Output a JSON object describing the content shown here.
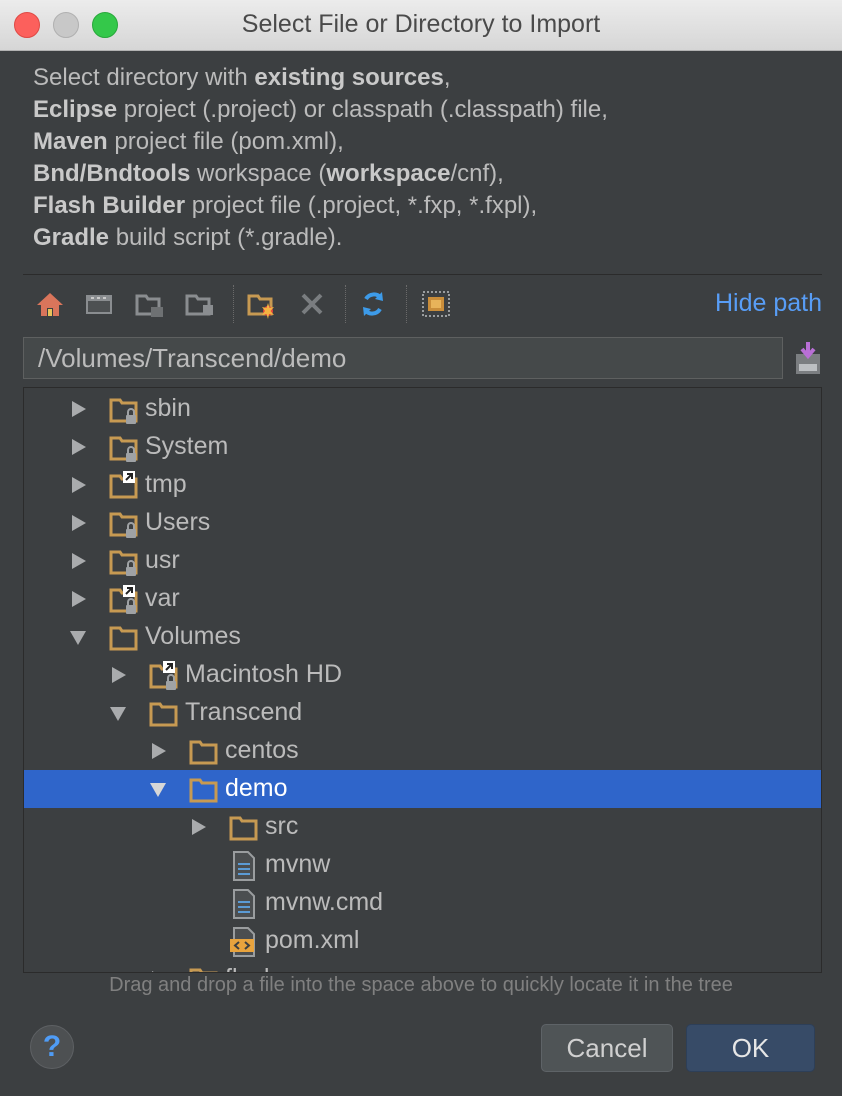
{
  "window": {
    "title": "Select File or Directory to Import"
  },
  "description": [
    [
      {
        "t": "Select directory with ",
        "b": false
      },
      {
        "t": "existing sources",
        "b": true
      },
      {
        "t": ",",
        "b": false
      }
    ],
    [
      {
        "t": "Eclipse",
        "b": true
      },
      {
        "t": " project (.project) or classpath (.classpath) file,",
        "b": false
      }
    ],
    [
      {
        "t": "Maven",
        "b": true
      },
      {
        "t": " project file (pom.xml),",
        "b": false
      }
    ],
    [
      {
        "t": "Bnd/Bndtools",
        "b": true
      },
      {
        "t": " workspace (",
        "b": false
      },
      {
        "t": "workspace",
        "b": true
      },
      {
        "t": "/cnf),",
        "b": false
      }
    ],
    [
      {
        "t": "Flash Builder",
        "b": true
      },
      {
        "t": " project file (.project, *.fxp, *.fxpl),",
        "b": false
      }
    ],
    [
      {
        "t": "Gradle",
        "b": true
      },
      {
        "t": " build script (*.gradle).",
        "b": false
      }
    ]
  ],
  "toolbar": {
    "icons": [
      "home-icon",
      "desktop-icon",
      "project-folder-icon",
      "module-folder-icon",
      "new-folder-icon",
      "delete-icon",
      "refresh-icon",
      "show-hidden-icon"
    ],
    "hide_path": "Hide path"
  },
  "path": {
    "value": "/Volumes/Transcend/demo"
  },
  "tree": [
    {
      "label": "sbin",
      "depth": 0,
      "expand": "collapsed",
      "icon": "folder-locked"
    },
    {
      "label": "System",
      "depth": 0,
      "expand": "collapsed",
      "icon": "folder-locked"
    },
    {
      "label": "tmp",
      "depth": 0,
      "expand": "collapsed",
      "icon": "folder-link"
    },
    {
      "label": "Users",
      "depth": 0,
      "expand": "collapsed",
      "icon": "folder-locked"
    },
    {
      "label": "usr",
      "depth": 0,
      "expand": "collapsed",
      "icon": "folder-locked"
    },
    {
      "label": "var",
      "depth": 0,
      "expand": "collapsed",
      "icon": "folder-link-locked"
    },
    {
      "label": "Volumes",
      "depth": 0,
      "expand": "expanded",
      "icon": "folder"
    },
    {
      "label": "Macintosh HD",
      "depth": 1,
      "expand": "collapsed",
      "icon": "folder-link-locked"
    },
    {
      "label": "Transcend",
      "depth": 1,
      "expand": "expanded",
      "icon": "folder"
    },
    {
      "label": "centos",
      "depth": 2,
      "expand": "collapsed",
      "icon": "folder"
    },
    {
      "label": "demo",
      "depth": 2,
      "expand": "expanded",
      "icon": "folder",
      "selected": true
    },
    {
      "label": "src",
      "depth": 3,
      "expand": "collapsed",
      "icon": "folder"
    },
    {
      "label": "mvnw",
      "depth": 3,
      "expand": "none",
      "icon": "text-file"
    },
    {
      "label": "mvnw.cmd",
      "depth": 3,
      "expand": "none",
      "icon": "text-file"
    },
    {
      "label": "pom.xml",
      "depth": 3,
      "expand": "none",
      "icon": "xml-file"
    },
    {
      "label": "flash",
      "depth": 2,
      "expand": "collapsed",
      "icon": "folder"
    }
  ],
  "hint": "Drag and drop a file into the space above to quickly locate it in the tree",
  "buttons": {
    "help": "?",
    "cancel": "Cancel",
    "ok": "OK"
  }
}
